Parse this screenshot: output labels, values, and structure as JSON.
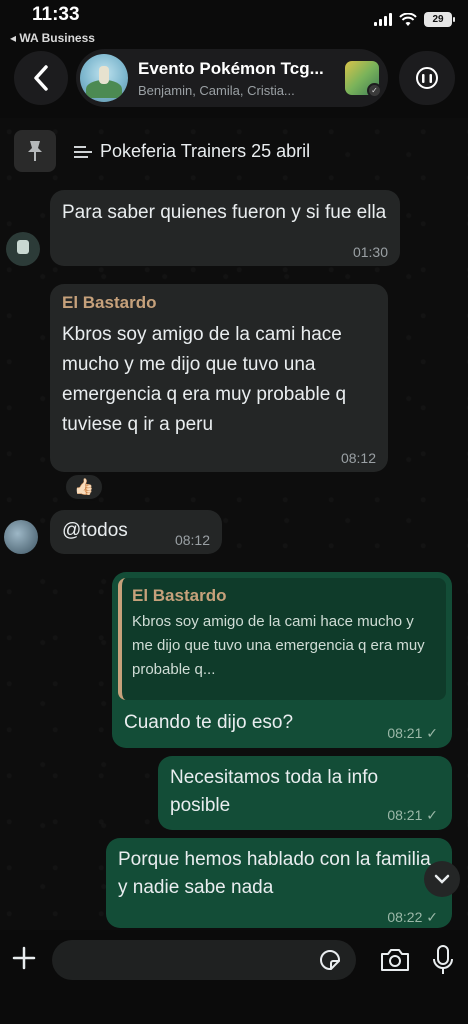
{
  "status_bar": {
    "time": "11:33",
    "back_app": "◂ WA Business",
    "battery": "29"
  },
  "header": {
    "title": "Evento Pokémon Tcg...",
    "subtitle": "Benjamin, Camila, Cristia..."
  },
  "pinned": {
    "text": "Pokeferia Trainers 25 abril"
  },
  "messages": [
    {
      "direction": "in",
      "text": "Para saber quienes fueron y si fue ella",
      "time": "01:30"
    },
    {
      "direction": "in",
      "sender": "El Bastardo",
      "text": "Kbros soy amigo de la cami hace mucho y me dijo que tuvo una emergencia q era muy probable q tuviese q ir a peru",
      "time": "08:12",
      "reaction": "👍🏻"
    },
    {
      "direction": "in",
      "text": "@todos",
      "time": "08:12"
    },
    {
      "direction": "out",
      "quote_sender": "El Bastardo",
      "quote_text": "Kbros soy amigo de la cami hace mucho y me dijo que tuvo una emergencia q era muy probable q...",
      "text": "Cuando te dijo eso?",
      "time": "08:21 ✓"
    },
    {
      "direction": "out",
      "text": "Necesitamos toda la info posible",
      "time": "08:21 ✓"
    },
    {
      "direction": "out",
      "text": "Porque hemos hablado con la familia  y nadie sabe nada",
      "time": "08:22 ✓"
    }
  ],
  "composer": {
    "placeholder": ""
  },
  "colors": {
    "incoming_bubble": "#242626",
    "outgoing_bubble": "#134d37",
    "sender_name": "#c6a17b",
    "background": "#0d0d0d"
  },
  "icons": [
    "back-chevron-icon",
    "phone-icon",
    "pin-icon",
    "list-icon",
    "chevron-down-icon",
    "plus-icon",
    "sticker-icon",
    "camera-icon",
    "microphone-icon"
  ]
}
